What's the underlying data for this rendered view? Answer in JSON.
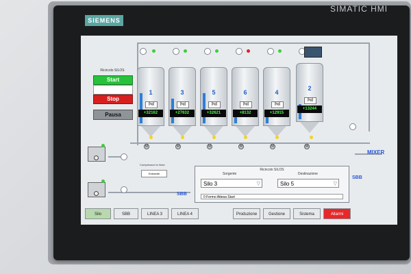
{
  "device": {
    "brand": "SIEMENS",
    "model": "SIMATIC HMI"
  },
  "control_panel": {
    "title": "Ricircolo SILOS",
    "start": "Start",
    "stop": "Stop",
    "pausa": "Pausa"
  },
  "silos": [
    {
      "number": "1",
      "unit": "[kg]",
      "value": "+32162",
      "fill": 0.55
    },
    {
      "number": "3",
      "unit": "[kg]",
      "value": "+27632",
      "fill": 0.45
    },
    {
      "number": "5",
      "unit": "[kg]",
      "value": "+32621",
      "fill": 0.55
    },
    {
      "number": "6",
      "unit": "[kg]",
      "value": "+8132",
      "fill": 0.15
    },
    {
      "number": "4",
      "unit": "[kg]",
      "value": "+12915",
      "fill": 0.25
    },
    {
      "number": "2",
      "unit": "[kg]",
      "value": "+13244",
      "fill": 0.28
    }
  ],
  "destinations": {
    "mixer": "MIXER",
    "sbb_right": "SBB",
    "sbb_bottom": "SBB"
  },
  "compressor": {
    "label": "Compressori in linea",
    "button": "Entrambi"
  },
  "ricircolo": {
    "title": "Ricircolo SILOS",
    "source_label": "Sorgente",
    "dest_label": "Destinazione",
    "source_value": "Silo 3",
    "dest_value": "Silo 5",
    "status": "0  Fermo Attesa Start"
  },
  "tabs": [
    {
      "label": "Silo",
      "active": true
    },
    {
      "label": "SBB"
    },
    {
      "label": "LINEA 3"
    },
    {
      "label": "LINEA 4"
    },
    {
      "label": "Produzione"
    },
    {
      "label": "Gestione"
    },
    {
      "label": "Sistema"
    },
    {
      "label": "Allarmi",
      "alarm": true
    }
  ],
  "colors": {
    "accent": "#2a55d6",
    "start": "#28c23a",
    "stop": "#d81f1f",
    "alarm": "#e8272a",
    "display_text": "#4dff4d"
  }
}
